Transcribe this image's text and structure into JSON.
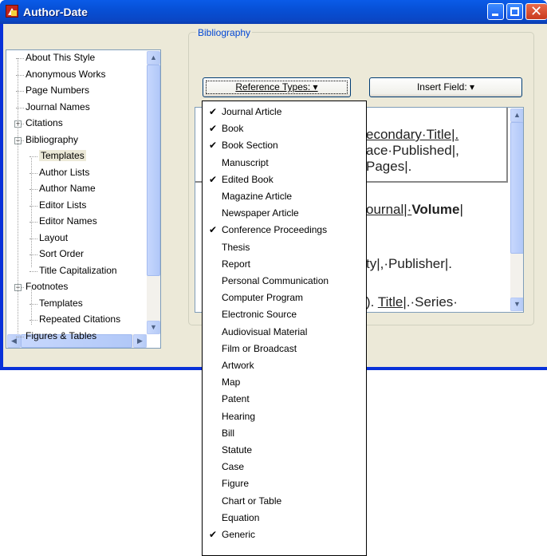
{
  "window": {
    "title": "Author-Date"
  },
  "tree": {
    "items": [
      {
        "label": "About This Style"
      },
      {
        "label": "Anonymous Works"
      },
      {
        "label": "Page Numbers"
      },
      {
        "label": "Journal Names"
      },
      {
        "label": "Citations",
        "expander": "+"
      },
      {
        "label": "Bibliography",
        "expander": "−"
      },
      {
        "label": "Templates",
        "selected": true
      },
      {
        "label": "Author Lists"
      },
      {
        "label": "Author Name"
      },
      {
        "label": "Editor Lists"
      },
      {
        "label": "Editor Names"
      },
      {
        "label": "Layout"
      },
      {
        "label": "Sort Order"
      },
      {
        "label": "Title Capitalization"
      },
      {
        "label": "Footnotes",
        "expander": "−"
      },
      {
        "label": "Templates"
      },
      {
        "label": "Repeated Citations"
      },
      {
        "label": "Figures & Tables"
      }
    ]
  },
  "bibliography": {
    "group_label": "Bibliography",
    "reference_types_button": "Reference Types: ▾",
    "insert_field_button": "Insert Field: ▾"
  },
  "editor": {
    "line1": "econdary·Title|.",
    "line2": "ace·Published|,",
    "line3": "Pages|.",
    "line4_a": "ournal|·",
    "line4_b": "Volume",
    "line4_c": "|",
    "line5": "ty|,·Publisher|.",
    "line6_a": "). ",
    "line6_b": "Title",
    "line6_c": "|.·Series·"
  },
  "menu": {
    "items": [
      {
        "label": "Journal Article",
        "checked": true
      },
      {
        "label": "Book",
        "checked": true
      },
      {
        "label": "Book Section",
        "checked": true
      },
      {
        "label": "Manuscript",
        "checked": false
      },
      {
        "label": "Edited Book",
        "checked": true
      },
      {
        "label": "Magazine Article",
        "checked": false
      },
      {
        "label": "Newspaper Article",
        "checked": false
      },
      {
        "label": "Conference Proceedings",
        "checked": true
      },
      {
        "label": "Thesis",
        "checked": false
      },
      {
        "label": "Report",
        "checked": false
      },
      {
        "label": "Personal Communication",
        "checked": false
      },
      {
        "label": "Computer Program",
        "checked": false
      },
      {
        "label": "Electronic Source",
        "checked": false
      },
      {
        "label": "Audiovisual Material",
        "checked": false
      },
      {
        "label": "Film or Broadcast",
        "checked": false
      },
      {
        "label": "Artwork",
        "checked": false
      },
      {
        "label": "Map",
        "checked": false
      },
      {
        "label": "Patent",
        "checked": false
      },
      {
        "label": "Hearing",
        "checked": false
      },
      {
        "label": "Bill",
        "checked": false
      },
      {
        "label": "Statute",
        "checked": false
      },
      {
        "label": "Case",
        "checked": false
      },
      {
        "label": "Figure",
        "checked": false
      },
      {
        "label": "Chart or Table",
        "checked": false
      },
      {
        "label": "Equation",
        "checked": false
      },
      {
        "label": "Generic",
        "checked": true
      }
    ],
    "check_glyph": "✔"
  },
  "icons": {
    "app": "endnote-app-icon",
    "minimize": "minimize-icon",
    "maximize": "maximize-icon",
    "close": "close-icon"
  },
  "colors": {
    "titlebar": "#0a5be8",
    "group_label": "#0046d5",
    "window_bg": "#ece9d8"
  }
}
